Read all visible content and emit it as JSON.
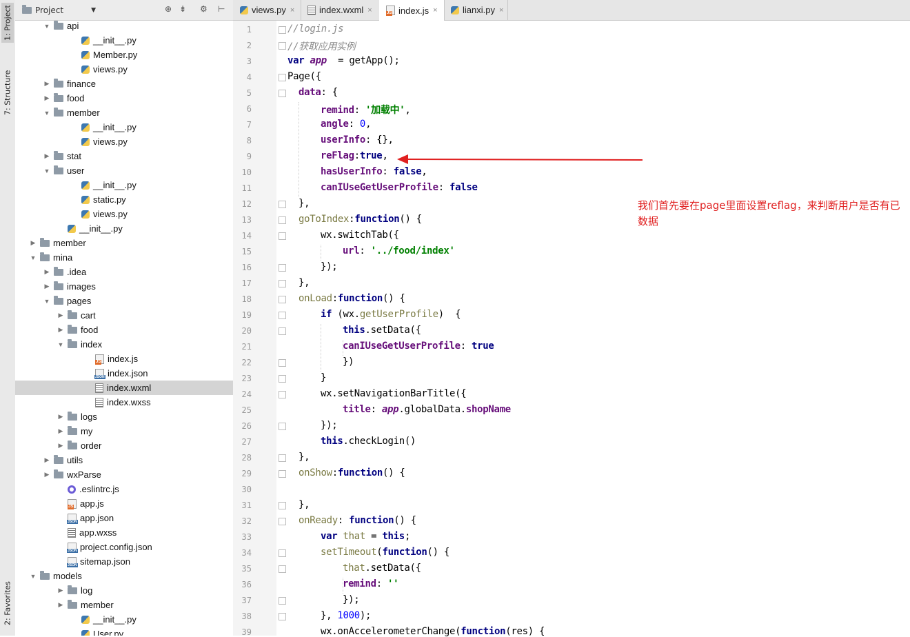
{
  "side_stripe": {
    "top_tabs": [
      "1: Project",
      "7: Structure"
    ],
    "bottom_tabs": [
      "2: Favorites"
    ]
  },
  "project_panel": {
    "title": "Project",
    "toolbar_icons": [
      "globe-icon",
      "collapse-icon",
      "gear-icon",
      "hide-icon"
    ],
    "tree": [
      {
        "depth": 3,
        "type": "folder",
        "state": "open",
        "name": "api"
      },
      {
        "depth": 5,
        "type": "py",
        "name": "__init__.py"
      },
      {
        "depth": 5,
        "type": "py",
        "name": "Member.py"
      },
      {
        "depth": 5,
        "type": "py",
        "name": "views.py"
      },
      {
        "depth": 3,
        "type": "folder",
        "state": "closed",
        "name": "finance"
      },
      {
        "depth": 3,
        "type": "folder",
        "state": "closed",
        "name": "food"
      },
      {
        "depth": 3,
        "type": "folder",
        "state": "open",
        "name": "member"
      },
      {
        "depth": 5,
        "type": "py",
        "name": "__init__.py"
      },
      {
        "depth": 5,
        "type": "py",
        "name": "views.py"
      },
      {
        "depth": 3,
        "type": "folder",
        "state": "closed",
        "name": "stat"
      },
      {
        "depth": 3,
        "type": "folder",
        "state": "open",
        "name": "user"
      },
      {
        "depth": 5,
        "type": "py",
        "name": "__init__.py"
      },
      {
        "depth": 5,
        "type": "py",
        "name": "static.py"
      },
      {
        "depth": 5,
        "type": "py",
        "name": "views.py"
      },
      {
        "depth": 4,
        "type": "py",
        "name": "__init__.py"
      },
      {
        "depth": 2,
        "type": "folder",
        "state": "closed",
        "name": "member"
      },
      {
        "depth": 2,
        "type": "folder",
        "state": "open",
        "name": "mina"
      },
      {
        "depth": 3,
        "type": "folder",
        "state": "closed",
        "name": ".idea"
      },
      {
        "depth": 3,
        "type": "folder",
        "state": "closed",
        "name": "images"
      },
      {
        "depth": 3,
        "type": "folder",
        "state": "open",
        "name": "pages"
      },
      {
        "depth": 4,
        "type": "folder",
        "state": "closed",
        "name": "cart"
      },
      {
        "depth": 4,
        "type": "folder",
        "state": "closed",
        "name": "food"
      },
      {
        "depth": 4,
        "type": "folder",
        "state": "open",
        "name": "index"
      },
      {
        "depth": 6,
        "type": "js",
        "name": "index.js"
      },
      {
        "depth": 6,
        "type": "json",
        "name": "index.json"
      },
      {
        "depth": 6,
        "type": "doc",
        "name": "index.wxml",
        "selected": true
      },
      {
        "depth": 6,
        "type": "doc",
        "name": "index.wxss"
      },
      {
        "depth": 4,
        "type": "folder",
        "state": "closed",
        "name": "logs"
      },
      {
        "depth": 4,
        "type": "folder",
        "state": "closed",
        "name": "my"
      },
      {
        "depth": 4,
        "type": "folder",
        "state": "closed",
        "name": "order"
      },
      {
        "depth": 3,
        "type": "folder",
        "state": "closed",
        "name": "utils"
      },
      {
        "depth": 3,
        "type": "folder",
        "state": "closed",
        "name": "wxParse"
      },
      {
        "depth": 4,
        "type": "cfg",
        "name": ".eslintrc.js"
      },
      {
        "depth": 4,
        "type": "js",
        "name": "app.js"
      },
      {
        "depth": 4,
        "type": "json",
        "name": "app.json"
      },
      {
        "depth": 4,
        "type": "doc",
        "name": "app.wxss"
      },
      {
        "depth": 4,
        "type": "json",
        "name": "project.config.json"
      },
      {
        "depth": 4,
        "type": "json",
        "name": "sitemap.json"
      },
      {
        "depth": 2,
        "type": "folder",
        "state": "open",
        "name": "models"
      },
      {
        "depth": 4,
        "type": "folder",
        "state": "closed",
        "name": "log"
      },
      {
        "depth": 4,
        "type": "folder",
        "state": "closed",
        "name": "member"
      },
      {
        "depth": 5,
        "type": "py",
        "name": "__init__.py"
      },
      {
        "depth": 5,
        "type": "py",
        "name": "User.py"
      }
    ]
  },
  "editor_tabs": [
    {
      "label": "views.py",
      "type": "py",
      "active": false
    },
    {
      "label": "index.wxml",
      "type": "doc",
      "active": false
    },
    {
      "label": "index.js",
      "type": "js",
      "active": true
    },
    {
      "label": "lianxi.py",
      "type": "py",
      "active": false
    }
  ],
  "code_lines": [
    {
      "n": 1,
      "indent": 0,
      "tokens": [
        [
          "cm",
          "//login.js"
        ]
      ]
    },
    {
      "n": 2,
      "indent": 0,
      "tokens": [
        [
          "cm",
          "//获取应用实例"
        ]
      ]
    },
    {
      "n": 3,
      "indent": 0,
      "tokens": [
        [
          "kw",
          "var "
        ],
        [
          "var",
          "app"
        ],
        [
          "",
          "  = getApp();"
        ]
      ]
    },
    {
      "n": 4,
      "indent": 0,
      "tokens": [
        [
          "",
          "Page({"
        ]
      ]
    },
    {
      "n": 5,
      "indent": 1,
      "tokens": [
        [
          "prop",
          "data"
        ],
        [
          "",
          ": {"
        ]
      ]
    },
    {
      "n": 6,
      "indent": 3,
      "tokens": [
        [
          "prop",
          "remind"
        ],
        [
          "",
          ": "
        ],
        [
          "str",
          "'加载中'"
        ],
        [
          "",
          ","
        ]
      ]
    },
    {
      "n": 7,
      "indent": 3,
      "tokens": [
        [
          "prop",
          "angle"
        ],
        [
          "",
          ": "
        ],
        [
          "num",
          "0"
        ],
        [
          "",
          ","
        ]
      ]
    },
    {
      "n": 8,
      "indent": 3,
      "tokens": [
        [
          "prop",
          "userInfo"
        ],
        [
          "",
          ": {},"
        ]
      ]
    },
    {
      "n": 9,
      "indent": 3,
      "tokens": [
        [
          "prop",
          "reFlag"
        ],
        [
          "",
          ":"
        ],
        [
          "kw",
          "true"
        ],
        [
          "",
          ","
        ]
      ]
    },
    {
      "n": 10,
      "indent": 3,
      "tokens": [
        [
          "prop",
          "hasUserInfo"
        ],
        [
          "",
          ": "
        ],
        [
          "kw",
          "false"
        ],
        [
          "",
          ","
        ]
      ]
    },
    {
      "n": 11,
      "indent": 3,
      "tokens": [
        [
          "prop",
          "canIUseGetUserProfile"
        ],
        [
          "",
          ": "
        ],
        [
          "kw",
          "false"
        ]
      ]
    },
    {
      "n": 12,
      "indent": 1,
      "tokens": [
        [
          "",
          "},"
        ]
      ]
    },
    {
      "n": 13,
      "indent": 1,
      "tokens": [
        [
          "fn",
          "goToIndex"
        ],
        [
          "",
          ":"
        ],
        [
          "kw",
          "function"
        ],
        [
          "",
          "() {"
        ]
      ]
    },
    {
      "n": 14,
      "indent": 3,
      "tokens": [
        [
          "",
          "wx.switchTab({"
        ]
      ]
    },
    {
      "n": 15,
      "indent": 5,
      "tokens": [
        [
          "prop",
          "url"
        ],
        [
          "",
          ": "
        ],
        [
          "str",
          "'../food/index'"
        ]
      ]
    },
    {
      "n": 16,
      "indent": 3,
      "tokens": [
        [
          "",
          "});"
        ]
      ]
    },
    {
      "n": 17,
      "indent": 1,
      "tokens": [
        [
          "",
          "},"
        ]
      ]
    },
    {
      "n": 18,
      "indent": 1,
      "tokens": [
        [
          "fn",
          "onLoad"
        ],
        [
          "",
          ":"
        ],
        [
          "kw",
          "function"
        ],
        [
          "",
          "() {"
        ]
      ]
    },
    {
      "n": 19,
      "indent": 3,
      "tokens": [
        [
          "kw",
          "if "
        ],
        [
          "",
          "(wx."
        ],
        [
          "fn",
          "getUserProfile"
        ],
        [
          "",
          ")  {"
        ]
      ]
    },
    {
      "n": 20,
      "indent": 5,
      "tokens": [
        [
          "kw",
          "this"
        ],
        [
          "",
          ".setData({"
        ]
      ]
    },
    {
      "n": 21,
      "indent": 5,
      "tokens": [
        [
          "prop",
          "canIUseGetUserProfile"
        ],
        [
          "",
          ": "
        ],
        [
          "kw",
          "true"
        ]
      ]
    },
    {
      "n": 22,
      "indent": 5,
      "tokens": [
        [
          "",
          "})"
        ]
      ]
    },
    {
      "n": 23,
      "indent": 3,
      "tokens": [
        [
          "",
          "}"
        ]
      ]
    },
    {
      "n": 24,
      "indent": 3,
      "tokens": [
        [
          "",
          "wx.setNavigationBarTitle({"
        ]
      ]
    },
    {
      "n": 25,
      "indent": 5,
      "tokens": [
        [
          "prop",
          "title"
        ],
        [
          "",
          ": "
        ],
        [
          "var",
          "app"
        ],
        [
          "",
          ".globalData."
        ],
        [
          "prop",
          "shopName"
        ]
      ]
    },
    {
      "n": 26,
      "indent": 3,
      "tokens": [
        [
          "",
          "});"
        ]
      ]
    },
    {
      "n": 27,
      "indent": 3,
      "tokens": [
        [
          "kw",
          "this"
        ],
        [
          "",
          ".checkLogin()"
        ]
      ]
    },
    {
      "n": 28,
      "indent": 1,
      "tokens": [
        [
          "",
          "},"
        ]
      ]
    },
    {
      "n": 29,
      "indent": 1,
      "tokens": [
        [
          "fn",
          "onShow"
        ],
        [
          "",
          ":"
        ],
        [
          "kw",
          "function"
        ],
        [
          "",
          "() {"
        ]
      ]
    },
    {
      "n": 30,
      "indent": 0,
      "tokens": []
    },
    {
      "n": 31,
      "indent": 1,
      "tokens": [
        [
          "",
          "},"
        ]
      ]
    },
    {
      "n": 32,
      "indent": 1,
      "tokens": [
        [
          "fn",
          "onReady"
        ],
        [
          "",
          ": "
        ],
        [
          "kw",
          "function"
        ],
        [
          "",
          "() {"
        ]
      ]
    },
    {
      "n": 33,
      "indent": 3,
      "tokens": [
        [
          "kw",
          "var "
        ],
        [
          "fn",
          "that"
        ],
        [
          "",
          " = "
        ],
        [
          "kw",
          "this"
        ],
        [
          "",
          ";"
        ]
      ]
    },
    {
      "n": 34,
      "indent": 3,
      "tokens": [
        [
          "fn",
          "setTimeout"
        ],
        [
          "",
          "("
        ],
        [
          "kw",
          "function"
        ],
        [
          "",
          "() {"
        ]
      ]
    },
    {
      "n": 35,
      "indent": 5,
      "tokens": [
        [
          "fn",
          "that"
        ],
        [
          "",
          ".setData({"
        ]
      ]
    },
    {
      "n": 36,
      "indent": 5,
      "tokens": [
        [
          "prop",
          "remind"
        ],
        [
          "",
          ": "
        ],
        [
          "str",
          "''"
        ]
      ]
    },
    {
      "n": 37,
      "indent": 5,
      "tokens": [
        [
          "",
          "});"
        ]
      ]
    },
    {
      "n": 38,
      "indent": 3,
      "tokens": [
        [
          "",
          "}, "
        ],
        [
          "num",
          "1000"
        ],
        [
          "",
          ");"
        ]
      ]
    },
    {
      "n": 39,
      "indent": 3,
      "tokens": [
        [
          "",
          "wx.onAccelerometerChange("
        ],
        [
          "kw",
          "function"
        ],
        [
          "",
          "(res) {"
        ]
      ]
    }
  ],
  "annotation": {
    "text": "我们首先要在page里面设置reflag，来判断用户是否有已数据",
    "color": "#e02020"
  }
}
